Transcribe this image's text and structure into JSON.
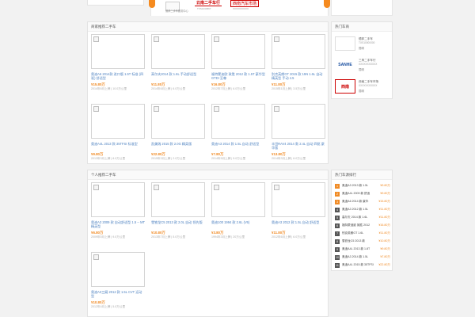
{
  "banner": {
    "thumb_caption": "德邦二手车服务中心",
    "logo1": "云南二手车行",
    "logo1_sub": "TXS1234567",
    "logo2": "西南汽车市场",
    "logo2_sub": "XXXXXXXXXX",
    "arrow_left_icon": "chevron-left-icon",
    "arrow_right_icon": "chevron-right-icon",
    "accent": "#f58a1f"
  },
  "merchant": {
    "header": "商家推荐二手车",
    "cars": [
      {
        "title": "奥迪A6 2014款 进口版 1.5T 标准 (四驱) 舒适型",
        "price": "¥15.80万",
        "meta": "2014年6月上牌 | 10.0万公里"
      },
      {
        "title": "高尔夫2014 款 1.6L 手动舒适型",
        "price": "¥11.80万",
        "meta": "2014年6月上牌 | 6.0万公里"
      },
      {
        "title": "福特蒙迪欧 致胜 2012 款 1.5T 豪华型 GTDI 至尊",
        "price": "¥16.80万",
        "meta": "2012年7月上牌 | 6.0万公里"
      },
      {
        "title": "别克英朗GT 2015 款 15N 1.6L 自动 精英型 手动 4.5",
        "price": "¥11.80万",
        "meta": "2015年1月上牌 | 3.5万公里"
      },
      {
        "title": "奥迪A4L 2013 款 35TFSI 标准型",
        "price": "¥9.80万",
        "meta": "2013年3月上牌 | 8.0万公里"
      },
      {
        "title": "凯美瑞 2015 款 2.0G 精英版",
        "price": "¥22.80万",
        "meta": "2015年3月上牌 | 2.0万公里"
      },
      {
        "title": "奥迪A3 2014 款 1.5L 自动 舒适型",
        "price": "¥7.80万",
        "meta": "2014年5月上牌 | 5.0万公里"
      },
      {
        "title": "丰田RAV4 2014 款 2.4L 自动 四驱 豪华版",
        "price": "¥13.80万",
        "meta": "2014年3月上牌 | 6.0万公里"
      }
    ]
  },
  "personal": {
    "header": "个人推荐二手车",
    "cars": [
      {
        "title": "奥迪A3 2009 款 自动舒适型 1.5 -- MT 精英型",
        "price": "¥6.80万",
        "meta": "2009年5月上牌 | 9.0万公里"
      },
      {
        "title": "雪铁龙C5 2013 款 2.0L 自动 领先版",
        "price": "¥10.80万",
        "meta": "2013年7月上牌 | 5.0万公里"
      },
      {
        "title": "奥迪100 1994 款 2.6L (V6)",
        "price": "¥3.80万",
        "meta": "1994年3月上牌 | 20万公里"
      },
      {
        "title": "奥迪A3 2012 款 1.5L 自动 舒适型",
        "price": "¥11.80万",
        "meta": "2012年6月上牌 | 6.0万公里"
      },
      {
        "title": "奥迪A3三厢 2012 款 1.5L CVT 运动型",
        "price": "¥10.80万",
        "meta": "2012年4月上牌 | 5.0万公里"
      }
    ]
  },
  "dealers": {
    "header": "热门车商",
    "items": [
      {
        "logo": "",
        "name": "德邦二手车",
        "sub": "TXS10000000",
        "loc": "昆明"
      },
      {
        "logo": "SANHE",
        "name": "三禾二手车行",
        "sub": "XXXXXXXXXXX",
        "loc": "昆明"
      },
      {
        "logo": "西南",
        "name": "西南二手车市场",
        "sub": "XXXXXXXXXXX",
        "loc": "昆明"
      }
    ]
  },
  "ranking": {
    "header": "热门车源排行",
    "items": [
      {
        "name": "奥迪A3 2013 款 1.5L",
        "price": "¥9.80万"
      },
      {
        "name": "奥迪A4L 2009 款 舒适",
        "price": "¥9.80万"
      },
      {
        "name": "奥迪A6 2014 款 豪华",
        "price": "¥15.80万"
      },
      {
        "name": "奥迪A3 2012 款 1.5L",
        "price": "¥11.80万"
      },
      {
        "name": "高尔夫 2014 款 1.6L",
        "price": "¥11.80万"
      },
      {
        "name": "福特蒙迪欧 致胜 2012",
        "price": "¥16.80万"
      },
      {
        "name": "别克英朗GT 1.6L",
        "price": "¥11.80万"
      },
      {
        "name": "雪铁龙C5 2013 款",
        "price": "¥10.80万"
      },
      {
        "name": "奥迪A4L 2013 款 1.8T",
        "price": "¥9.80万"
      },
      {
        "name": "奥迪A3 2014 款 1.5L",
        "price": "¥7.80万"
      },
      {
        "name": "奥迪A4L 2015 款 35TFSI",
        "price": "¥22.80万"
      }
    ],
    "rank_colors": [
      "#f08a24",
      "#f08a24",
      "#f08a24",
      "#555555"
    ]
  }
}
